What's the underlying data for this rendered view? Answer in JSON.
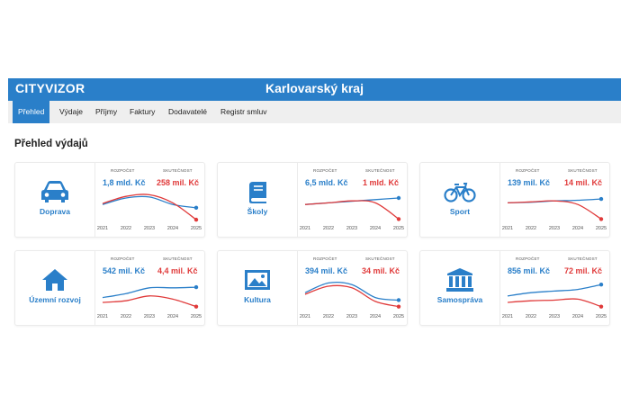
{
  "app": {
    "logo": "CITYVIZOR",
    "region": "Karlovarský kraj"
  },
  "nav": {
    "tabs": [
      "Přehled",
      "Výdaje",
      "Příjmy",
      "Faktury",
      "Dodavatelé",
      "Registr smluv"
    ],
    "active": 0
  },
  "page": {
    "title": "Přehled výdajů"
  },
  "colors": {
    "accent": "#2a7fc9",
    "budget": "#2a7fc9",
    "actual": "#e03a3a"
  },
  "chart_data": [
    {
      "type": "line",
      "title": "Doprava",
      "icon": "car-icon",
      "x": [
        2021,
        2022,
        2023,
        2024,
        2025
      ],
      "budget_label": "ROZPOČET",
      "actual_label": "SKUTEČNOST",
      "budget_value": "1,8 mld. Kč",
      "actual_value": "258 mil. Kč",
      "series": [
        {
          "values": [
            0.55,
            0.75,
            0.78,
            0.55,
            0.45
          ]
        },
        {
          "values": [
            0.58,
            0.8,
            0.85,
            0.6,
            0.08
          ]
        }
      ]
    },
    {
      "type": "line",
      "title": "Školy",
      "icon": "book-icon",
      "x": [
        2021,
        2022,
        2023,
        2024,
        2025
      ],
      "budget_label": "ROZPOČET",
      "actual_label": "SKUTEČNOST",
      "budget_value": "6,5 mld. Kč",
      "actual_value": "1 mld. Kč",
      "series": [
        {
          "values": [
            0.55,
            0.6,
            0.65,
            0.7,
            0.75
          ]
        },
        {
          "values": [
            0.55,
            0.6,
            0.66,
            0.6,
            0.1
          ]
        }
      ]
    },
    {
      "type": "line",
      "title": "Sport",
      "icon": "bicycle-icon",
      "x": [
        2021,
        2022,
        2023,
        2024,
        2025
      ],
      "budget_label": "ROZPOČET",
      "actual_label": "SKUTEČNOST",
      "budget_value": "139 mil. Kč",
      "actual_value": "14 mil. Kč",
      "series": [
        {
          "values": [
            0.6,
            0.62,
            0.66,
            0.68,
            0.72
          ]
        },
        {
          "values": [
            0.6,
            0.63,
            0.66,
            0.55,
            0.1
          ]
        }
      ]
    },
    {
      "type": "line",
      "title": "Územní rozvoj",
      "icon": "house-icon",
      "x": [
        2021,
        2022,
        2023,
        2024,
        2025
      ],
      "budget_label": "ROZPOČET",
      "actual_label": "SKUTEČNOST",
      "budget_value": "542 mil. Kč",
      "actual_value": "4,4 mil. Kč",
      "series": [
        {
          "values": [
            0.4,
            0.52,
            0.7,
            0.7,
            0.72
          ]
        },
        {
          "values": [
            0.25,
            0.3,
            0.45,
            0.35,
            0.12
          ]
        }
      ]
    },
    {
      "type": "line",
      "title": "Kultura",
      "icon": "picture-icon",
      "x": [
        2021,
        2022,
        2023,
        2024,
        2025
      ],
      "budget_label": "ROZPOČET",
      "actual_label": "SKUTEČNOST",
      "budget_value": "394 mil. Kč",
      "actual_value": "34 mil. Kč",
      "series": [
        {
          "values": [
            0.55,
            0.85,
            0.8,
            0.4,
            0.32
          ]
        },
        {
          "values": [
            0.5,
            0.75,
            0.7,
            0.28,
            0.12
          ]
        }
      ]
    },
    {
      "type": "line",
      "title": "Samospráva",
      "icon": "building-icon",
      "x": [
        2021,
        2022,
        2023,
        2024,
        2025
      ],
      "budget_label": "ROZPOČET",
      "actual_label": "SKUTEČNOST",
      "budget_value": "856 mil. Kč",
      "actual_value": "72 mil. Kč",
      "series": [
        {
          "values": [
            0.45,
            0.55,
            0.6,
            0.65,
            0.8
          ]
        },
        {
          "values": [
            0.25,
            0.3,
            0.32,
            0.35,
            0.12
          ]
        }
      ]
    }
  ]
}
